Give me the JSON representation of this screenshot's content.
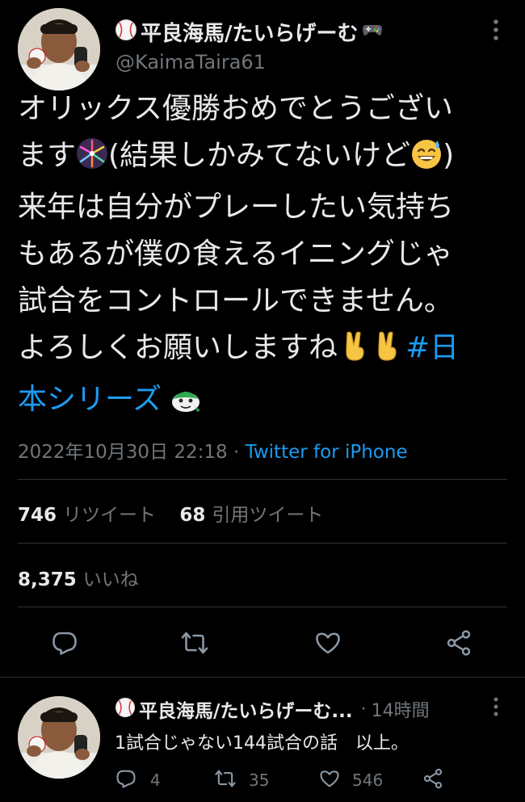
{
  "tweet": {
    "author": {
      "display_name": "平良海馬/たいらげーむ",
      "handle": "@KaimaTaira61"
    },
    "text_lines": [
      "オリックス優勝おめでとうござい",
      "ます",
      "(結果しかみてないけど",
      ")",
      "来年は自分がプレーしたい気持ち",
      "もあるが僕の食えるイニングじゃ",
      "試合をコントロールできません。",
      "よろしくお願いしますね",
      "#日",
      "本シリーズ"
    ],
    "timestamp": "2022年10月30日 22:18",
    "separator": " · ",
    "source": "Twitter for iPhone",
    "stats": {
      "retweets": "746",
      "retweets_label": "リツイート",
      "quotes": "68",
      "quotes_label": "引用ツイート",
      "likes": "8,375",
      "likes_label": "いいね"
    },
    "actions": [
      "reply-icon",
      "retweet-icon",
      "like-icon",
      "share-icon"
    ]
  },
  "reply": {
    "display_name": "平良海馬/たいらげーむ...",
    "separator": "·",
    "time": "14時間",
    "text": "1試合じゃない144試合の話　以上。",
    "counts": {
      "replies": "4",
      "retweets": "35",
      "likes": "546"
    }
  },
  "colors": {
    "background": "#000000",
    "text": "#e7e9ea",
    "secondary": "#71767b",
    "accent": "#1d9bf0",
    "divider": "#2f3336"
  }
}
